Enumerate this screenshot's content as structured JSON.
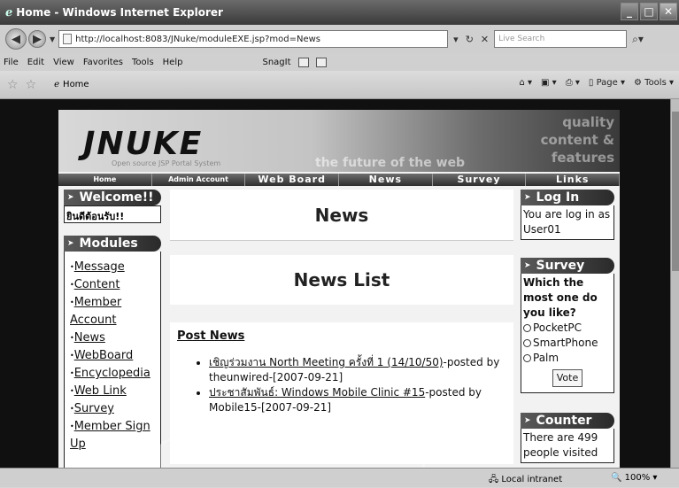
{
  "window": {
    "title": "Home - Windows Internet Explorer"
  },
  "address": {
    "url": "http://localhost:8083/JNuke/moduleEXE.jsp?mod=News",
    "search_placeholder": "Live Search"
  },
  "menu": [
    "File",
    "Edit",
    "View",
    "Favorites",
    "Tools",
    "Help"
  ],
  "snagit_label": "SnagIt",
  "tab": {
    "label": "Home"
  },
  "favtools": {
    "page": "Page",
    "tools": "Tools"
  },
  "site": {
    "logo": "JNUKE",
    "logo_sub": "Open source JSP Portal System",
    "tagline": "the future of the web",
    "corner_lines": [
      "quality",
      "content &",
      "features"
    ],
    "nav": [
      "Home",
      "Admin Account",
      "Web Board",
      "News",
      "Survey",
      "Links"
    ]
  },
  "left": {
    "welcome_title": "Welcome!!",
    "welcome_text": "ยินดีต้อนรับ!!",
    "modules_title": "Modules",
    "modules": [
      "Message",
      "Content",
      "Member Account",
      "News",
      "WebBoard",
      "Encyclopedia",
      "Web Link",
      "Survey",
      "Member Sign Up"
    ]
  },
  "center": {
    "title": "News",
    "list_title": "News List",
    "post_header": "Post News",
    "items": [
      {
        "link": "เชิญร่วมงาน North Meeting ครั้งที่ 1 (14/10/50)",
        "by": "-posted by theunwired-[2007-09-21]"
      },
      {
        "link": "ประชาสัมพันธ์: Windows Mobile Clinic #15",
        "by": "-posted by Mobile15-[2007-09-21]"
      }
    ]
  },
  "right": {
    "login_title": "Log In",
    "login_text": "You are log in as User01",
    "survey_title": "Survey",
    "survey_question": "Which the most one do you like?",
    "survey_options": [
      "PocketPC",
      "SmartPhone",
      "Palm"
    ],
    "vote_label": "Vote",
    "counter_title": "Counter",
    "counter_text": "There are 499 people visited"
  },
  "status": {
    "zone": "Local intranet",
    "zoom": "100%"
  }
}
